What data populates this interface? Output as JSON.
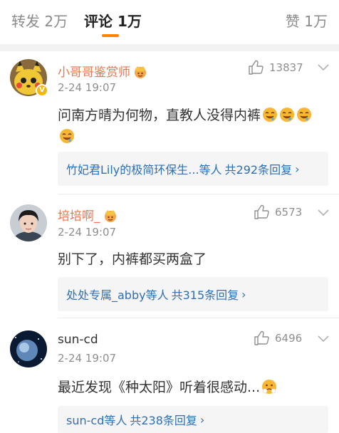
{
  "tabs": {
    "repost": "转发 2万",
    "comment": "评论 1万",
    "like": "赞 1万"
  },
  "comments": [
    {
      "name": "小哥哥鉴赏师",
      "time": "2-24 19:07",
      "likes": "13837",
      "text": "问南方晴为何物，直教人没得内裤",
      "replies_who": "竹妃君Lily的极简环保生...等人",
      "replies_count": "共292条回复",
      "verified_badge": "V"
    },
    {
      "name": "培培啊_",
      "time": "2-24 19:07",
      "likes": "6573",
      "text": "别下了，内裤都买两盒了",
      "replies_who": "处处专属_abby等人",
      "replies_count": "共315条回复"
    },
    {
      "name": "sun-cd",
      "time": "2-24 19:07",
      "likes": "6496",
      "text": "最近发现《种太阳》听着很感动...",
      "replies_who": "sun-cd等人",
      "replies_count": "共238条回复"
    }
  ],
  "icons": {
    "reply_arrow": "›"
  },
  "colors": {
    "accent": "#ff8200",
    "username_orange": "#eb7350",
    "link_blue": "#2f6fb4",
    "muted": "#8f8f8f"
  }
}
